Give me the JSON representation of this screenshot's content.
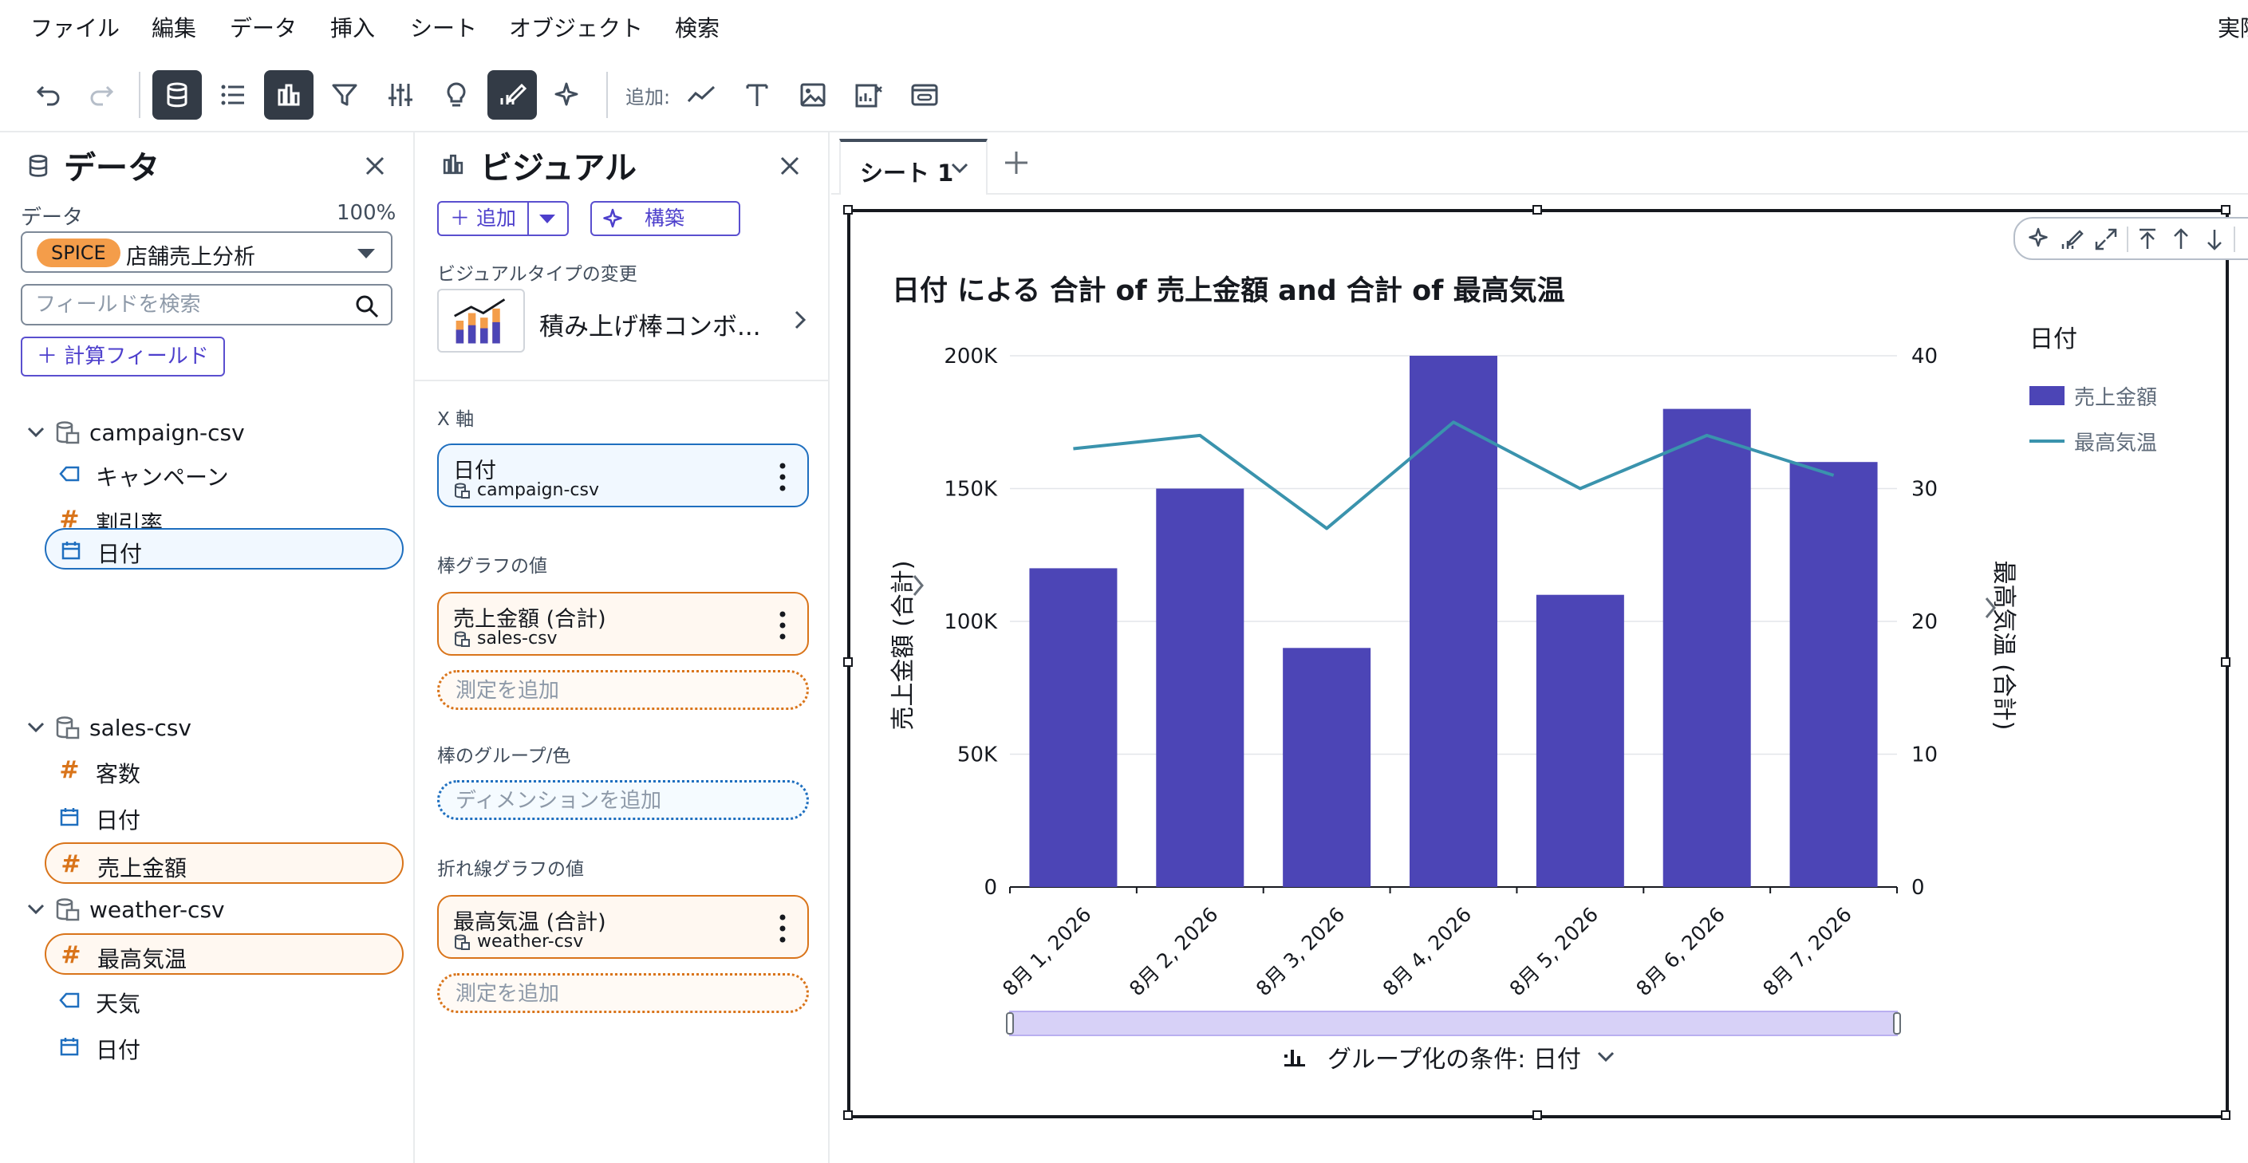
{
  "menubar": {
    "items": [
      "ファイル",
      "編集",
      "データ",
      "挿入",
      "シート",
      "オブジェクト",
      "検索"
    ],
    "right_text": "実際"
  },
  "toolbar": {
    "add_label": "追加:"
  },
  "data_panel": {
    "title": "データ",
    "dataset_label": "データ",
    "dataset_percent": "100%",
    "spice_badge": "SPICE",
    "dataset_name": "店舗売上分析",
    "search_placeholder": "フィールドを検索",
    "calc_field_label": "＋ 計算フィールド",
    "datasets": [
      {
        "name": "campaign-csv",
        "fields": [
          {
            "label": "キャンペーン",
            "type": "dimension",
            "selected": ""
          },
          {
            "label": "割引率",
            "type": "measure",
            "selected": ""
          },
          {
            "label": "日付",
            "type": "date",
            "selected": "blue"
          }
        ]
      },
      {
        "name": "sales-csv",
        "fields": [
          {
            "label": "客数",
            "type": "measure",
            "selected": ""
          },
          {
            "label": "日付",
            "type": "date",
            "selected": ""
          },
          {
            "label": "売上金額",
            "type": "measure",
            "selected": "orange"
          }
        ]
      },
      {
        "name": "weather-csv",
        "fields": [
          {
            "label": "最高気温",
            "type": "measure",
            "selected": "orange"
          },
          {
            "label": "天気",
            "type": "dimension",
            "selected": ""
          },
          {
            "label": "日付",
            "type": "date",
            "selected": ""
          }
        ]
      }
    ]
  },
  "visual_panel": {
    "title": "ビジュアル",
    "add_label": "＋ 追加",
    "build_label": "構築",
    "change_type_label": "ビジュアルタイプの変更",
    "visual_type_name": "積み上げ棒コンボ...",
    "x_axis": {
      "label": "X 軸",
      "field": "日付",
      "source": "campaign-csv"
    },
    "bar_values": {
      "label": "棒グラフの値",
      "field": "売上金額 (合計)",
      "source": "sales-csv",
      "add_placeholder": "測定を追加"
    },
    "bar_group": {
      "label": "棒のグループ/色",
      "add_placeholder": "ディメンションを追加"
    },
    "line_values": {
      "label": "折れ線グラフの値",
      "field": "最高気温 (合計)",
      "source": "weather-csv",
      "add_placeholder": "測定を追加"
    }
  },
  "sheet": {
    "tab_label": "シート 1"
  },
  "visual": {
    "title": "日付 による 合計 of 売上金額 and 合計 of 最高気温",
    "legend_title": "日付",
    "group_by_label": "グループ化の条件: 日付"
  },
  "chart_data": {
    "type": "bar",
    "title": "日付 による 合計 of 売上金額 and 合計 of 最高気温",
    "categories": [
      "8月 1, 2026",
      "8月 2, 2026",
      "8月 3, 2026",
      "8月 4, 2026",
      "8月 5, 2026",
      "8月 6, 2026",
      "8月 7, 2026"
    ],
    "series": [
      {
        "name": "売上金額",
        "type": "bar",
        "axis": "left",
        "values": [
          120000,
          150000,
          90000,
          200000,
          110000,
          180000,
          160000
        ],
        "color": "#4c45b6"
      },
      {
        "name": "最高気温",
        "type": "line",
        "axis": "right",
        "values": [
          33,
          34,
          27,
          35,
          30,
          34,
          31
        ],
        "color": "#3a93ad"
      }
    ],
    "ylabel": "売上金額 (合計)",
    "y2label": "最高気温 (合計)",
    "ylim": [
      0,
      200000
    ],
    "y2lim": [
      0,
      40
    ],
    "yticks": [
      "0",
      "50K",
      "100K",
      "150K",
      "200K"
    ],
    "y2ticks": [
      "0",
      "10",
      "20",
      "30",
      "40"
    ],
    "grid": true,
    "legend": "right",
    "scrollbar_color": "#d7d1f7"
  }
}
